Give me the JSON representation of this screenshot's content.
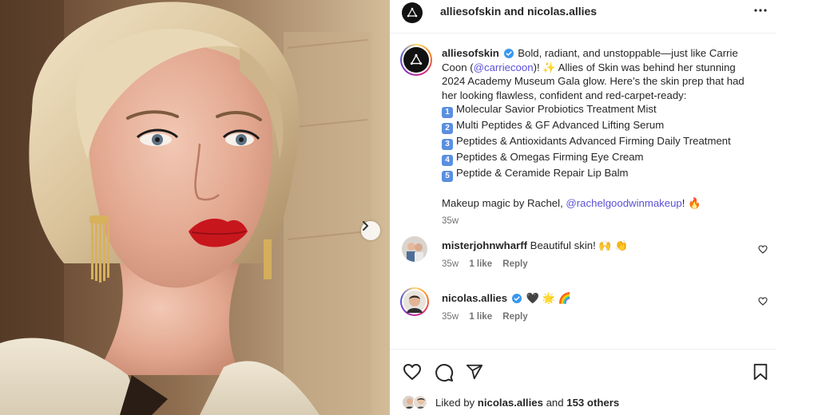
{
  "post": {
    "header": {
      "author": "alliesofskin",
      "and": "and",
      "collaborator": "nicolas.allies"
    },
    "caption": {
      "username": "alliesofskin",
      "text_1": "Bold, radiant, and unstoppable—just like Carrie Coon (",
      "mention_1": "@carriecoon",
      "text_2": ")! ✨ Allies of Skin was behind her stunning 2024 Academy Museum Gala glow. Here’s the skin prep that had her looking flawless, confident and red-carpet-ready:",
      "products": [
        {
          "num": "1",
          "name": "Molecular Savior Probiotics Treatment Mist"
        },
        {
          "num": "2",
          "name": "Multi Peptides & GF Advanced Lifting Serum"
        },
        {
          "num": "3",
          "name": "Peptides & Antioxidants Advanced Firming Daily Treatment"
        },
        {
          "num": "4",
          "name": "Peptides & Omegas Firming Eye Cream"
        },
        {
          "num": "5",
          "name": "Peptide & Ceramide Repair Lip Balm"
        }
      ],
      "makeup_text": "Makeup magic by Rachel, ",
      "mention_2": "@rachelgoodwinmakeup",
      "makeup_end": "! 🔥",
      "time": "35w"
    },
    "comments": [
      {
        "username": "misterjohnwharff",
        "text": "Beautiful skin! 🙌 👏",
        "time": "35w",
        "likes": "1 like",
        "reply": "Reply"
      },
      {
        "username": "nicolas.allies",
        "text": "🖤 🌟 🌈",
        "time": "35w",
        "likes": "1 like",
        "reply": "Reply"
      }
    ],
    "liked_by": {
      "prefix": "Liked by",
      "user": "nicolas.allies",
      "middle": "and",
      "others": "153 others"
    }
  },
  "colors": {
    "mention": "#5b51d8",
    "verified": "#3897f0",
    "meta_text": "#737373",
    "lipstick": "#c8161d"
  },
  "icons": [
    "more-icon",
    "verified-icon",
    "heart-icon",
    "comment-icon",
    "share-icon",
    "bookmark-icon",
    "chevron-right-icon"
  ]
}
